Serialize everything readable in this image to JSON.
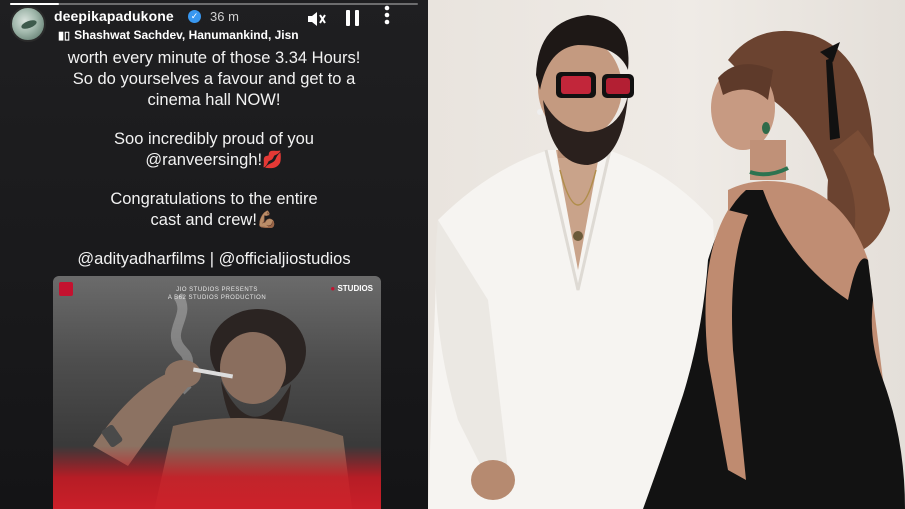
{
  "story": {
    "progress": 0.12,
    "username": "deepikapadukone",
    "verified_icon": "verified-badge-icon",
    "timestamp": "36 m",
    "music": "Shashwat Sachdev, Hanumankind, Jisn",
    "controls": {
      "mute": "mute-icon",
      "pause": "pause-icon",
      "more": "more-options-icon"
    },
    "lines": [
      "worth every minute of those 3.34 Hours!",
      "So do yourselves a favour and get to a",
      "cinema hall NOW!",
      "Soo incredibly proud of you",
      "@ranveersingh!💋",
      "Congratulations to the entire",
      "cast and crew!💪🏽",
      "@adityadharfilms | @officialjiostudios"
    ],
    "poster": {
      "credit_top": "JIO STUDIOS",
      "credit_mid": "PRESENTS",
      "credit_bottom": "A B62 STUDIOS PRODUCTION",
      "studio_logo": "STUDIOS"
    }
  },
  "colors": {
    "story_bg": "#1c1c1e",
    "verified": "#3897f0",
    "poster_red": "#d0202a",
    "photo_bg": "#ece7e1"
  }
}
